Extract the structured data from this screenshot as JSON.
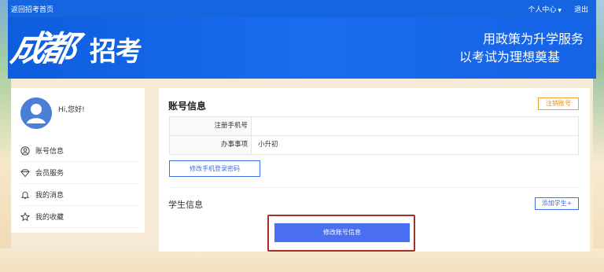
{
  "topbar": {
    "home_link": "返回招考首页",
    "user_center": "个人中心",
    "logout": "退出"
  },
  "banner": {
    "logo_calligraphy": "成都",
    "logo_bold": "招考",
    "slogan_line1": "用政策为升学服务",
    "slogan_line2": "以考试为理想奠基"
  },
  "sidebar": {
    "greeting": "Hi,您好!",
    "items": [
      {
        "label": "账号信息",
        "icon": "user-circle-icon"
      },
      {
        "label": "会员服务",
        "icon": "diamond-icon"
      },
      {
        "label": "我的消息",
        "icon": "bell-icon"
      },
      {
        "label": "我的收藏",
        "icon": "star-icon"
      }
    ]
  },
  "main": {
    "account_title": "账号信息",
    "cancel_account": "注销账号",
    "rows": [
      {
        "key": "注册手机号",
        "value": ""
      },
      {
        "key": "办事事项",
        "value": "小升初"
      }
    ],
    "change_password": "修改手机登录密码",
    "student_title": "学生信息",
    "add_student": "添加学生+",
    "edit_account": "修改账号信息"
  },
  "colors": {
    "brand_blue": "#1565e0",
    "button_blue": "#4a6ff0",
    "warning_orange": "#f0a030",
    "highlight_red": "#a4312a"
  }
}
